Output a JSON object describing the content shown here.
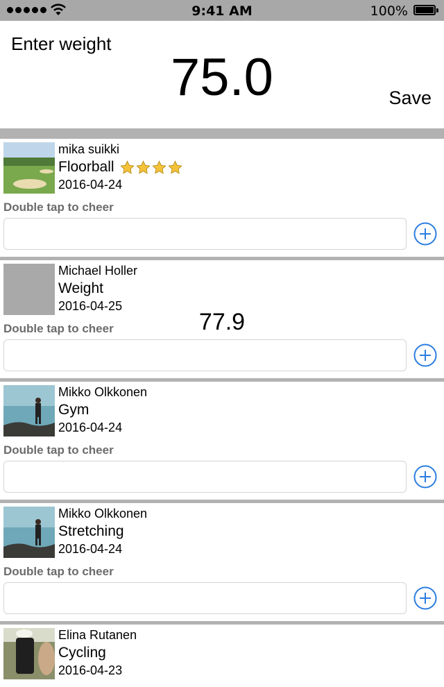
{
  "status_bar": {
    "time": "9:41 AM",
    "battery_percent": "100%",
    "battery_level": 1.0,
    "signal_bars": 5
  },
  "header": {
    "label": "Enter weight",
    "weight_value": "75.0",
    "save_label": "Save"
  },
  "colors": {
    "accent": "#2a7de1",
    "separator": "#b2b2b2",
    "status_bar_bg": "#a8a8a8",
    "hint_text": "#6b6b6b",
    "star": "#f2c23a"
  },
  "feed": {
    "items": [
      {
        "name": "mika suikki",
        "activity": "Floorball",
        "rating": 4,
        "date": "2016-04-24",
        "cheer_hint": "Double tap to cheer",
        "metric": "",
        "thumbnail": "golf-course-photo",
        "comment_value": ""
      },
      {
        "name": "Michael Holler",
        "activity": "Weight",
        "rating": 0,
        "date": "2016-04-25",
        "cheer_hint": "Double tap to cheer",
        "metric": "77.9",
        "thumbnail": "placeholder-image",
        "comment_value": ""
      },
      {
        "name": "Mikko Olkkonen",
        "activity": "Gym",
        "rating": 0,
        "date": "2016-04-24",
        "cheer_hint": "Double tap to cheer",
        "metric": "",
        "thumbnail": "person-by-sea-photo",
        "comment_value": ""
      },
      {
        "name": "Mikko Olkkonen",
        "activity": "Stretching",
        "rating": 0,
        "date": "2016-04-24",
        "cheer_hint": "Double tap to cheer",
        "metric": "",
        "thumbnail": "person-by-sea-photo",
        "comment_value": ""
      },
      {
        "name": "Elina Rutanen",
        "activity": "Cycling",
        "rating": 0,
        "date": "2016-04-23",
        "thumbnail": "selfie-photo"
      }
    ]
  }
}
